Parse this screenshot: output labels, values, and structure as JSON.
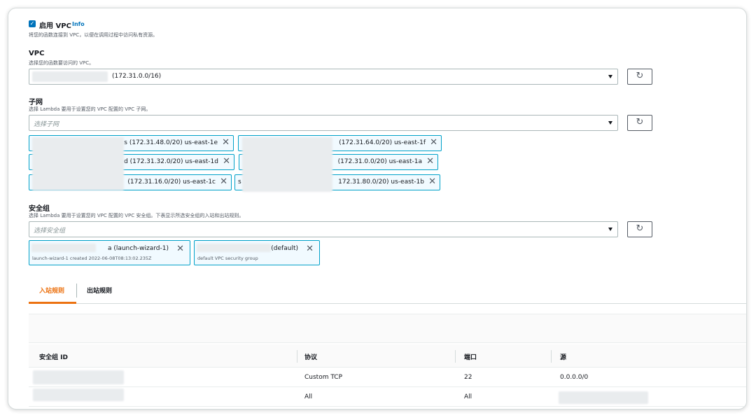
{
  "vpc_toggle": {
    "label": "启用 VPC",
    "info": "Info",
    "description": "将您的函数连接到 VPC，以便在调用过程中访问私有资源。",
    "checked": true
  },
  "vpc": {
    "label": "VPC",
    "description": "选择您的函数要访问的 VPC。",
    "value": "(172.31.0.0/16)"
  },
  "subnet": {
    "label": "子网",
    "description": "选择 Lambda 要用于设置您的 VPC 配置的 VPC 子网。",
    "placeholder": "选择子网",
    "tokens": [
      {
        "text": "s (172.31.48.0/20)  us-east-1e"
      },
      {
        "text": "(172.31.64.0/20)  us-east-1f"
      },
      {
        "text": "d (172.31.32.0/20)  us-east-1d"
      },
      {
        "text": "(172.31.0.0/20)  us-east-1a"
      },
      {
        "text": "(172.31.16.0/20)  us-east-1c"
      },
      {
        "text": "172.31.80.0/20)  us-east-1b"
      }
    ],
    "token_prefix_s": "s"
  },
  "security_group": {
    "label": "安全组",
    "description": "选择 Lambda 要用于设置您的 VPC 配置的 VPC 安全组。下表显示所选安全组的入站和出站规则。",
    "placeholder": "选择安全组",
    "tokens": [
      {
        "name": "a (launch-wizard-1)",
        "desc": "launch-wizard-1 created 2022-06-08T08:13:02.235Z"
      },
      {
        "name": "(default)",
        "desc": "default VPC security group"
      }
    ]
  },
  "tabs": [
    {
      "label": "入站规则",
      "active": true
    },
    {
      "label": "出站规则",
      "active": false
    }
  ],
  "table": {
    "headers": [
      "安全组 ID",
      "协议",
      "端口",
      "源"
    ],
    "rows": [
      {
        "protocol": "Custom TCP",
        "port": "22",
        "source": "0.0.0.0/0"
      },
      {
        "protocol": "All",
        "port": "All",
        "source": ""
      }
    ]
  },
  "icons": {
    "refresh": "refresh-icon",
    "caret": "caret-down-icon",
    "remove": "close-icon",
    "check": "checkbox-checked-icon"
  },
  "colors": {
    "accent_blue": "#0073bb",
    "token_border": "#00a1c9",
    "tab_active": "#ec7211"
  }
}
